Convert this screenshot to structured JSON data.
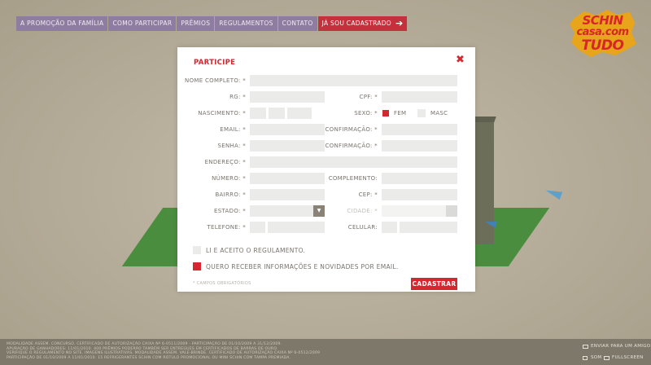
{
  "nav": {
    "items": [
      "A promoção da família",
      "Como participar",
      "Prêmios",
      "Regulamentos",
      "Contato"
    ],
    "cta": "Já sou cadastrado"
  },
  "logo": {
    "line1": "SCHIN",
    "line2": "casa.com",
    "line3": "TUDO"
  },
  "form": {
    "title": "PARTICIPE",
    "labels": {
      "nome": "NOME COMPLETO: *",
      "rg": "RG: *",
      "cpf": "CPF: *",
      "nascimento": "NASCIMENTO: *",
      "sexo": "SEXO: *",
      "email": "EMAIL: *",
      "email_confirm": "CONFIRMAÇÃO: *",
      "senha": "SENHA: *",
      "senha_confirm": "CONFIRMAÇÃO: *",
      "endereco": "ENDEREÇO: *",
      "numero": "NÚMERO: *",
      "complemento": "COMPLEMENTO:",
      "bairro": "BAIRRO: *",
      "cep": "CEP: *",
      "estado": "ESTADO: *",
      "cidade": "CIDADE: *",
      "telefone": "TELEFONE: *",
      "celular": "CELULAR:"
    },
    "sex_options": [
      "FEM",
      "MASC"
    ],
    "sex_selected": "FEM",
    "agree_regulation": "LI E ACEITO O REGULAMENTO.",
    "agree_regulation_checked": false,
    "newsletter": "QUERO RECEBER INFORMAÇÕES E NOVIDADES POR EMAIL.",
    "newsletter_checked": true,
    "required_note": "* CAMPOS OBRIGATÓRIOS",
    "submit": "CADASTRAR"
  },
  "footer": {
    "legal": [
      "MODALIDADE ASSEM. CONCURSO. CERTIFICADO DE AUTORIZAÇÃO CAIXA Nº 6-0511/2009 - PARTICIPAÇÃO DE 01/10/2009 A 31/12/2009.",
      "APURAÇÃO DE GANHADORES: 11/01/2010. 400 PRÊMIOS PODERÃO TAMBÉM SER ENTREGUES EM CERTIFICADOS DE BARRAS DE OURO.",
      "VERIFIQUE O REGULAMENTO NO SITE. IMAGENS ILUSTRATIVAS. MODALIDADE ASSEM. VALE-BRINDE. CERTIFICADO DE AUTORIZAÇÃO CAIXA Nº 6-0512/2009",
      "PARTICIPAÇÃO DE 01/10/2009 A 11/01/2010. 15 REFRIGERANTES SCHIN COM RÓTULO PROMOCIONAL OU MINI SCHIN COM TAMPA PREMIADA."
    ],
    "send_friend": "ENVIAR PARA UM AMIGO",
    "sound": "SOM",
    "fullscreen": "FULLSCREEN"
  },
  "colors": {
    "accent": "#d6262f",
    "nav": "#8f7da0",
    "background": "#b7ae9b",
    "field": "#ebebe9"
  }
}
